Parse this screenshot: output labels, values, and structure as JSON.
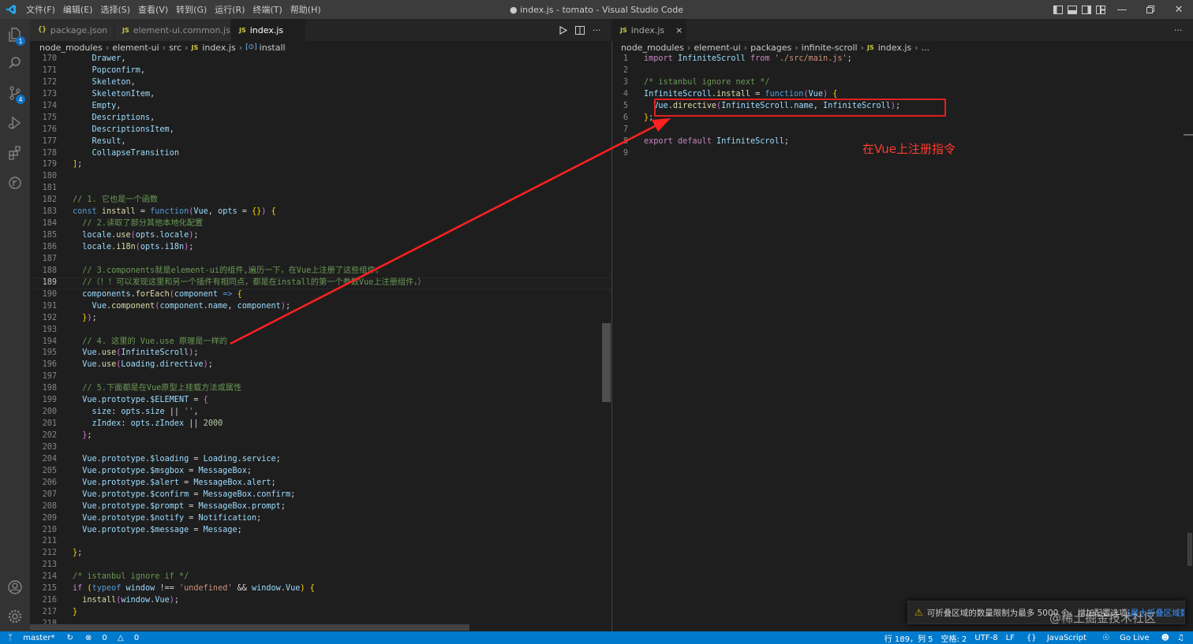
{
  "window": {
    "title": "● index.js - tomato - Visual Studio Code",
    "menu": [
      "文件(F)",
      "编辑(E)",
      "选择(S)",
      "查看(V)",
      "转到(G)",
      "运行(R)",
      "终端(T)",
      "帮助(H)"
    ]
  },
  "activity": {
    "scm_badge": "4",
    "explorer_badge": "1"
  },
  "left_tabs": [
    {
      "icon": "{}",
      "label": "package.json"
    },
    {
      "icon": "JS",
      "label": "element-ui.common.js"
    },
    {
      "icon": "JS",
      "label": "index.js"
    }
  ],
  "right_tabs": [
    {
      "icon": "JS",
      "label": "index.js",
      "close": "×"
    }
  ],
  "left_breadcrumb": [
    "node_modules",
    "element-ui",
    "src",
    "index.js",
    "install"
  ],
  "right_breadcrumb": [
    "node_modules",
    "element-ui",
    "packages",
    "infinite-scroll",
    "index.js",
    "..."
  ],
  "left_code": [
    {
      "n": "170",
      "t": [
        [
          "pl",
          "    "
        ],
        [
          "var",
          "Drawer"
        ],
        [
          "pl",
          ","
        ]
      ]
    },
    {
      "n": "171",
      "t": [
        [
          "pl",
          "    "
        ],
        [
          "var",
          "Popconfirm"
        ],
        [
          "pl",
          ","
        ]
      ]
    },
    {
      "n": "172",
      "t": [
        [
          "pl",
          "    "
        ],
        [
          "var",
          "Skeleton"
        ],
        [
          "pl",
          ","
        ]
      ]
    },
    {
      "n": "173",
      "t": [
        [
          "pl",
          "    "
        ],
        [
          "var",
          "SkeletonItem"
        ],
        [
          "pl",
          ","
        ]
      ]
    },
    {
      "n": "174",
      "t": [
        [
          "pl",
          "    "
        ],
        [
          "var",
          "Empty"
        ],
        [
          "pl",
          ","
        ]
      ]
    },
    {
      "n": "175",
      "t": [
        [
          "pl",
          "    "
        ],
        [
          "var",
          "Descriptions"
        ],
        [
          "pl",
          ","
        ]
      ]
    },
    {
      "n": "176",
      "t": [
        [
          "pl",
          "    "
        ],
        [
          "var",
          "DescriptionsItem"
        ],
        [
          "pl",
          ","
        ]
      ]
    },
    {
      "n": "177",
      "t": [
        [
          "pl",
          "    "
        ],
        [
          "var",
          "Result"
        ],
        [
          "pl",
          ","
        ]
      ]
    },
    {
      "n": "178",
      "t": [
        [
          "pl",
          "    "
        ],
        [
          "var",
          "CollapseTransition"
        ]
      ]
    },
    {
      "n": "179",
      "t": [
        [
          "br",
          "]"
        ],
        [
          "pl",
          ";"
        ]
      ]
    },
    {
      "n": "180",
      "t": []
    },
    {
      "n": "181",
      "t": []
    },
    {
      "n": "182",
      "t": [
        [
          "cm",
          "// 1. 它也是一个函数"
        ]
      ]
    },
    {
      "n": "183",
      "t": [
        [
          "kw",
          "const"
        ],
        [
          "pl",
          " "
        ],
        [
          "fn",
          "install"
        ],
        [
          "pl",
          " = "
        ],
        [
          "kw",
          "function"
        ],
        [
          "br2",
          "("
        ],
        [
          "var",
          "Vue"
        ],
        [
          "pl",
          ", "
        ],
        [
          "var",
          "opts"
        ],
        [
          "pl",
          " = "
        ],
        [
          "br",
          "{}"
        ],
        [
          "br2",
          ")"
        ],
        [
          "pl",
          " "
        ],
        [
          "br",
          "{"
        ]
      ]
    },
    {
      "n": "184",
      "t": [
        [
          "pl",
          "  "
        ],
        [
          "cm",
          "// 2.读取了部分其他本地化配置"
        ]
      ]
    },
    {
      "n": "185",
      "t": [
        [
          "pl",
          "  "
        ],
        [
          "var",
          "locale"
        ],
        [
          "pl",
          "."
        ],
        [
          "fn",
          "use"
        ],
        [
          "br2",
          "("
        ],
        [
          "var",
          "opts"
        ],
        [
          "pl",
          "."
        ],
        [
          "var",
          "locale"
        ],
        [
          "br2",
          ")"
        ],
        [
          "pl",
          ";"
        ]
      ]
    },
    {
      "n": "186",
      "t": [
        [
          "pl",
          "  "
        ],
        [
          "var",
          "locale"
        ],
        [
          "pl",
          "."
        ],
        [
          "fn",
          "i18n"
        ],
        [
          "br2",
          "("
        ],
        [
          "var",
          "opts"
        ],
        [
          "pl",
          "."
        ],
        [
          "var",
          "i18n"
        ],
        [
          "br2",
          ")"
        ],
        [
          "pl",
          ";"
        ]
      ]
    },
    {
      "n": "187",
      "t": []
    },
    {
      "n": "188",
      "t": [
        [
          "pl",
          "  "
        ],
        [
          "cm",
          "// 3.components就是element-ui的组件,遍历一下，在Vue上注册了这些组件。"
        ]
      ]
    },
    {
      "n": "189",
      "t": [
        [
          "pl",
          "  "
        ],
        [
          "cm",
          "//（！！可以发现这里和另一个插件有相同点，都是在install的第一个参数Vue上注册组件，）"
        ]
      ],
      "cur": true
    },
    {
      "n": "190",
      "t": [
        [
          "pl",
          "  "
        ],
        [
          "var",
          "components"
        ],
        [
          "pl",
          "."
        ],
        [
          "fn",
          "forEach"
        ],
        [
          "br2",
          "("
        ],
        [
          "var",
          "component"
        ],
        [
          "pl",
          " "
        ],
        [
          "kw",
          "=>"
        ],
        [
          "pl",
          " "
        ],
        [
          "br",
          "{"
        ]
      ]
    },
    {
      "n": "191",
      "t": [
        [
          "pl",
          "    "
        ],
        [
          "var",
          "Vue"
        ],
        [
          "pl",
          "."
        ],
        [
          "fn",
          "component"
        ],
        [
          "br2",
          "("
        ],
        [
          "var",
          "component"
        ],
        [
          "pl",
          "."
        ],
        [
          "var",
          "name"
        ],
        [
          "pl",
          ", "
        ],
        [
          "var",
          "component"
        ],
        [
          "br2",
          ")"
        ],
        [
          "pl",
          ";"
        ]
      ]
    },
    {
      "n": "192",
      "t": [
        [
          "pl",
          "  "
        ],
        [
          "br",
          "}"
        ],
        [
          "br2",
          ")"
        ],
        [
          "pl",
          ";"
        ]
      ]
    },
    {
      "n": "193",
      "t": []
    },
    {
      "n": "194",
      "t": [
        [
          "pl",
          "  "
        ],
        [
          "cm",
          "// 4. 这里的 Vue.use 原理是一样的"
        ]
      ]
    },
    {
      "n": "195",
      "t": [
        [
          "pl",
          "  "
        ],
        [
          "var",
          "Vue"
        ],
        [
          "pl",
          "."
        ],
        [
          "fn",
          "use"
        ],
        [
          "br2",
          "("
        ],
        [
          "var",
          "InfiniteScroll"
        ],
        [
          "br2",
          ")"
        ],
        [
          "pl",
          ";"
        ]
      ]
    },
    {
      "n": "196",
      "t": [
        [
          "pl",
          "  "
        ],
        [
          "var",
          "Vue"
        ],
        [
          "pl",
          "."
        ],
        [
          "fn",
          "use"
        ],
        [
          "br2",
          "("
        ],
        [
          "var",
          "Loading"
        ],
        [
          "pl",
          "."
        ],
        [
          "var",
          "directive"
        ],
        [
          "br2",
          ")"
        ],
        [
          "pl",
          ";"
        ]
      ]
    },
    {
      "n": "197",
      "t": []
    },
    {
      "n": "198",
      "t": [
        [
          "pl",
          "  "
        ],
        [
          "cm",
          "// 5.下面都是在Vue原型上挂载方法或属性"
        ]
      ]
    },
    {
      "n": "199",
      "t": [
        [
          "pl",
          "  "
        ],
        [
          "var",
          "Vue"
        ],
        [
          "pl",
          "."
        ],
        [
          "var",
          "prototype"
        ],
        [
          "pl",
          "."
        ],
        [
          "var",
          "$ELEMENT"
        ],
        [
          "pl",
          " = "
        ],
        [
          "br2",
          "{"
        ]
      ]
    },
    {
      "n": "200",
      "t": [
        [
          "pl",
          "    "
        ],
        [
          "var",
          "size"
        ],
        [
          "pl",
          ": "
        ],
        [
          "var",
          "opts"
        ],
        [
          "pl",
          "."
        ],
        [
          "var",
          "size"
        ],
        [
          "pl",
          " || "
        ],
        [
          "str",
          "''"
        ],
        [
          "pl",
          ","
        ]
      ]
    },
    {
      "n": "201",
      "t": [
        [
          "pl",
          "    "
        ],
        [
          "var",
          "zIndex"
        ],
        [
          "pl",
          ": "
        ],
        [
          "var",
          "opts"
        ],
        [
          "pl",
          "."
        ],
        [
          "var",
          "zIndex"
        ],
        [
          "pl",
          " || "
        ],
        [
          "num",
          "2000"
        ]
      ]
    },
    {
      "n": "202",
      "t": [
        [
          "pl",
          "  "
        ],
        [
          "br2",
          "}"
        ],
        [
          "pl",
          ";"
        ]
      ]
    },
    {
      "n": "203",
      "t": []
    },
    {
      "n": "204",
      "t": [
        [
          "pl",
          "  "
        ],
        [
          "var",
          "Vue"
        ],
        [
          "pl",
          "."
        ],
        [
          "var",
          "prototype"
        ],
        [
          "pl",
          "."
        ],
        [
          "var",
          "$loading"
        ],
        [
          "pl",
          " = "
        ],
        [
          "var",
          "Loading"
        ],
        [
          "pl",
          "."
        ],
        [
          "var",
          "service"
        ],
        [
          "pl",
          ";"
        ]
      ]
    },
    {
      "n": "205",
      "t": [
        [
          "pl",
          "  "
        ],
        [
          "var",
          "Vue"
        ],
        [
          "pl",
          "."
        ],
        [
          "var",
          "prototype"
        ],
        [
          "pl",
          "."
        ],
        [
          "var",
          "$msgbox"
        ],
        [
          "pl",
          " = "
        ],
        [
          "var",
          "MessageBox"
        ],
        [
          "pl",
          ";"
        ]
      ]
    },
    {
      "n": "206",
      "t": [
        [
          "pl",
          "  "
        ],
        [
          "var",
          "Vue"
        ],
        [
          "pl",
          "."
        ],
        [
          "var",
          "prototype"
        ],
        [
          "pl",
          "."
        ],
        [
          "var",
          "$alert"
        ],
        [
          "pl",
          " = "
        ],
        [
          "var",
          "MessageBox"
        ],
        [
          "pl",
          "."
        ],
        [
          "var",
          "alert"
        ],
        [
          "pl",
          ";"
        ]
      ]
    },
    {
      "n": "207",
      "t": [
        [
          "pl",
          "  "
        ],
        [
          "var",
          "Vue"
        ],
        [
          "pl",
          "."
        ],
        [
          "var",
          "prototype"
        ],
        [
          "pl",
          "."
        ],
        [
          "var",
          "$confirm"
        ],
        [
          "pl",
          " = "
        ],
        [
          "var",
          "MessageBox"
        ],
        [
          "pl",
          "."
        ],
        [
          "var",
          "confirm"
        ],
        [
          "pl",
          ";"
        ]
      ]
    },
    {
      "n": "208",
      "t": [
        [
          "pl",
          "  "
        ],
        [
          "var",
          "Vue"
        ],
        [
          "pl",
          "."
        ],
        [
          "var",
          "prototype"
        ],
        [
          "pl",
          "."
        ],
        [
          "var",
          "$prompt"
        ],
        [
          "pl",
          " = "
        ],
        [
          "var",
          "MessageBox"
        ],
        [
          "pl",
          "."
        ],
        [
          "var",
          "prompt"
        ],
        [
          "pl",
          ";"
        ]
      ]
    },
    {
      "n": "209",
      "t": [
        [
          "pl",
          "  "
        ],
        [
          "var",
          "Vue"
        ],
        [
          "pl",
          "."
        ],
        [
          "var",
          "prototype"
        ],
        [
          "pl",
          "."
        ],
        [
          "var",
          "$notify"
        ],
        [
          "pl",
          " = "
        ],
        [
          "var",
          "Notification"
        ],
        [
          "pl",
          ";"
        ]
      ]
    },
    {
      "n": "210",
      "t": [
        [
          "pl",
          "  "
        ],
        [
          "var",
          "Vue"
        ],
        [
          "pl",
          "."
        ],
        [
          "var",
          "prototype"
        ],
        [
          "pl",
          "."
        ],
        [
          "var",
          "$message"
        ],
        [
          "pl",
          " = "
        ],
        [
          "var",
          "Message"
        ],
        [
          "pl",
          ";"
        ]
      ]
    },
    {
      "n": "211",
      "t": []
    },
    {
      "n": "212",
      "t": [
        [
          "br",
          "}"
        ],
        [
          "pl",
          ";"
        ]
      ]
    },
    {
      "n": "213",
      "t": []
    },
    {
      "n": "214",
      "t": [
        [
          "cm",
          "/* istanbul ignore if */"
        ]
      ]
    },
    {
      "n": "215",
      "t": [
        [
          "ctl",
          "if"
        ],
        [
          "pl",
          " "
        ],
        [
          "br",
          "("
        ],
        [
          "kw",
          "typeof"
        ],
        [
          "pl",
          " "
        ],
        [
          "var",
          "window"
        ],
        [
          "pl",
          " !== "
        ],
        [
          "str",
          "'undefined'"
        ],
        [
          "pl",
          " && "
        ],
        [
          "var",
          "window"
        ],
        [
          "pl",
          "."
        ],
        [
          "var",
          "Vue"
        ],
        [
          "br",
          ")"
        ],
        [
          "pl",
          " "
        ],
        [
          "br",
          "{"
        ]
      ]
    },
    {
      "n": "216",
      "t": [
        [
          "pl",
          "  "
        ],
        [
          "fn",
          "install"
        ],
        [
          "br2",
          "("
        ],
        [
          "var",
          "window"
        ],
        [
          "pl",
          "."
        ],
        [
          "var",
          "Vue"
        ],
        [
          "br2",
          ")"
        ],
        [
          "pl",
          ";"
        ]
      ]
    },
    {
      "n": "217",
      "t": [
        [
          "br",
          "}"
        ]
      ]
    },
    {
      "n": "218",
      "t": []
    }
  ],
  "right_code": [
    {
      "n": "1",
      "t": [
        [
          "ctl",
          "import"
        ],
        [
          "pl",
          " "
        ],
        [
          "var",
          "InfiniteScroll"
        ],
        [
          "pl",
          " "
        ],
        [
          "ctl",
          "from"
        ],
        [
          "pl",
          " "
        ],
        [
          "str",
          "'./src/main.js'"
        ],
        [
          "pl",
          ";"
        ]
      ]
    },
    {
      "n": "2",
      "t": []
    },
    {
      "n": "3",
      "t": [
        [
          "cm",
          "/* istanbul ignore next */"
        ]
      ]
    },
    {
      "n": "4",
      "t": [
        [
          "var",
          "InfiniteScroll"
        ],
        [
          "pl",
          "."
        ],
        [
          "fn",
          "install"
        ],
        [
          "pl",
          " = "
        ],
        [
          "kw",
          "function"
        ],
        [
          "br2",
          "("
        ],
        [
          "var",
          "Vue"
        ],
        [
          "br2",
          ")"
        ],
        [
          "pl",
          " "
        ],
        [
          "br",
          "{"
        ]
      ]
    },
    {
      "n": "5",
      "t": [
        [
          "pl",
          "  "
        ],
        [
          "var",
          "Vue"
        ],
        [
          "pl",
          "."
        ],
        [
          "fn",
          "directive"
        ],
        [
          "br2",
          "("
        ],
        [
          "var",
          "InfiniteScroll"
        ],
        [
          "pl",
          "."
        ],
        [
          "var",
          "name"
        ],
        [
          "pl",
          ", "
        ],
        [
          "var",
          "InfiniteScroll"
        ],
        [
          "br2",
          ")"
        ],
        [
          "pl",
          ";"
        ]
      ]
    },
    {
      "n": "6",
      "t": [
        [
          "br",
          "}"
        ],
        [
          "pl",
          ";"
        ]
      ]
    },
    {
      "n": "7",
      "t": []
    },
    {
      "n": "8",
      "t": [
        [
          "ctl",
          "export"
        ],
        [
          "pl",
          " "
        ],
        [
          "ctl",
          "default"
        ],
        [
          "pl",
          " "
        ],
        [
          "var",
          "InfiniteScroll"
        ],
        [
          "pl",
          ";"
        ]
      ]
    },
    {
      "n": "9",
      "t": []
    }
  ],
  "annotation_text": "在Vue上注册指令",
  "notification": {
    "text": "可折叠区域的数量限制为最多 5000 个。增加配置选项",
    "link": "[最大折叠区域数..."
  },
  "watermark": "@稀土掘金技术社区",
  "status": {
    "branch": "master*",
    "errors": "0",
    "warnings": "0",
    "position": "行 189，列 5",
    "spaces": "空格: 2",
    "encoding": "UTF-8",
    "eol": "LF",
    "language": "JavaScript",
    "golive": "Go Live"
  },
  "colors": {
    "accent": "#007acc",
    "annotation": "#ff2020"
  }
}
